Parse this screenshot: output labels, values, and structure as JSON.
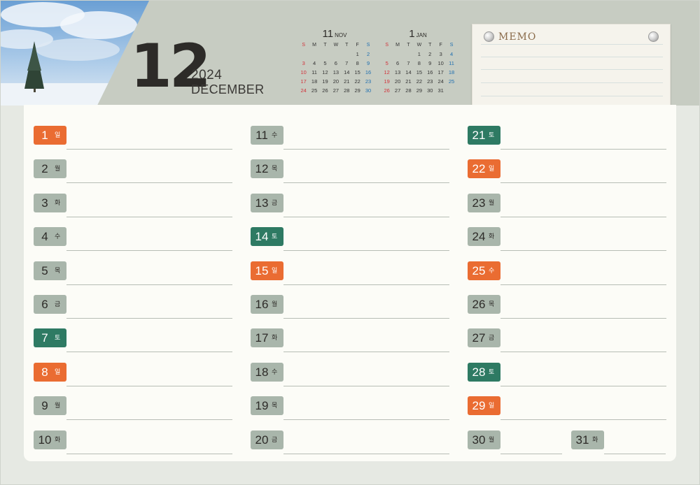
{
  "header": {
    "month_number": "12",
    "year": "2024",
    "month_name": "DECEMBER"
  },
  "mini_calendars": [
    {
      "month_number": "11",
      "month_abbr": "NOV",
      "weekday_headers": [
        "S",
        "M",
        "T",
        "W",
        "T",
        "F",
        "S"
      ],
      "first_weekday": 5,
      "days": 30
    },
    {
      "month_number": "1",
      "month_abbr": "JAN",
      "weekday_headers": [
        "S",
        "M",
        "T",
        "W",
        "T",
        "F",
        "S"
      ],
      "first_weekday": 3,
      "days": 31
    }
  ],
  "memo": {
    "title": "MEMO"
  },
  "days": [
    {
      "num": "1",
      "wd": "일",
      "type": "sun"
    },
    {
      "num": "2",
      "wd": "월",
      "type": "weekday"
    },
    {
      "num": "3",
      "wd": "화",
      "type": "weekday"
    },
    {
      "num": "4",
      "wd": "수",
      "type": "weekday"
    },
    {
      "num": "5",
      "wd": "목",
      "type": "weekday"
    },
    {
      "num": "6",
      "wd": "금",
      "type": "weekday"
    },
    {
      "num": "7",
      "wd": "토",
      "type": "sat"
    },
    {
      "num": "8",
      "wd": "일",
      "type": "sun"
    },
    {
      "num": "9",
      "wd": "월",
      "type": "weekday"
    },
    {
      "num": "10",
      "wd": "화",
      "type": "weekday"
    },
    {
      "num": "11",
      "wd": "수",
      "type": "weekday"
    },
    {
      "num": "12",
      "wd": "목",
      "type": "weekday"
    },
    {
      "num": "13",
      "wd": "금",
      "type": "weekday"
    },
    {
      "num": "14",
      "wd": "토",
      "type": "sat"
    },
    {
      "num": "15",
      "wd": "일",
      "type": "sun"
    },
    {
      "num": "16",
      "wd": "월",
      "type": "weekday"
    },
    {
      "num": "17",
      "wd": "화",
      "type": "weekday"
    },
    {
      "num": "18",
      "wd": "수",
      "type": "weekday"
    },
    {
      "num": "19",
      "wd": "목",
      "type": "weekday"
    },
    {
      "num": "20",
      "wd": "금",
      "type": "weekday"
    },
    {
      "num": "21",
      "wd": "토",
      "type": "sat"
    },
    {
      "num": "22",
      "wd": "일",
      "type": "sun"
    },
    {
      "num": "23",
      "wd": "월",
      "type": "weekday"
    },
    {
      "num": "24",
      "wd": "화",
      "type": "weekday"
    },
    {
      "num": "25",
      "wd": "수",
      "type": "sun"
    },
    {
      "num": "26",
      "wd": "목",
      "type": "weekday"
    },
    {
      "num": "27",
      "wd": "금",
      "type": "weekday"
    },
    {
      "num": "28",
      "wd": "토",
      "type": "sat"
    },
    {
      "num": "29",
      "wd": "일",
      "type": "sun"
    },
    {
      "num": "30",
      "wd": "월",
      "type": "weekday"
    },
    {
      "num": "31",
      "wd": "화",
      "type": "weekday"
    }
  ],
  "colors": {
    "sunday_holiday": "#ea6c32",
    "saturday": "#2e7a63",
    "weekday": "#a9b6ab",
    "mini_sunday": "#d2323a",
    "mini_saturday": "#1f6fb0"
  }
}
